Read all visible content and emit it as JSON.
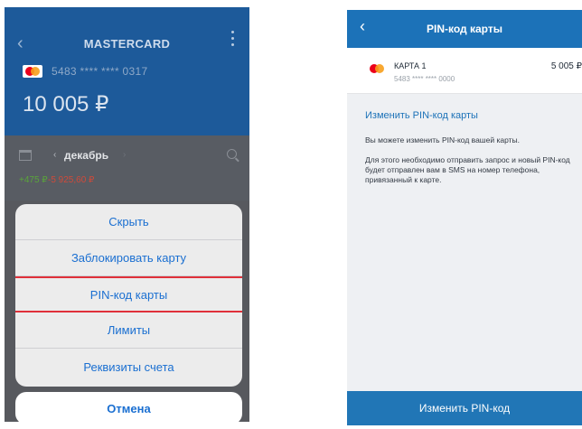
{
  "left_screen": {
    "header": {
      "title": "MASTERCARD",
      "back_icon": "chevron-left-icon",
      "more_icon": "vertical-dots-icon"
    },
    "card": {
      "logo_icon": "mastercard-logo-icon",
      "number": "5483 **** **** 0317",
      "balance": "10 005 ₽"
    },
    "filter": {
      "calendar_icon": "calendar-icon",
      "prev_icon": "‹",
      "month": "декабрь",
      "next_icon": "›",
      "search_icon": "search-icon",
      "income": "+475 ₽",
      "expense": "-5 925,60 ₽"
    },
    "action_sheet": {
      "items": [
        {
          "label": "Скрыть",
          "highlighted": false
        },
        {
          "label": "Заблокировать карту",
          "highlighted": false
        },
        {
          "label": "PIN-код карты",
          "highlighted": true
        },
        {
          "label": "Лимиты",
          "highlighted": false
        },
        {
          "label": "Реквизиты счета",
          "highlighted": false
        }
      ],
      "cancel_label": "Отмена"
    }
  },
  "right_screen": {
    "header": {
      "title": "PIN-код карты",
      "back_icon": "chevron-left-icon"
    },
    "card": {
      "logo_icon": "mastercard-logo-icon",
      "name": "КАРТА 1",
      "number": "5483 **** **** 0000",
      "amount": "5 005 ₽"
    },
    "change_link": "Изменить PIN-код карты",
    "info_text_1": "Вы можете изменить PIN-код вашей карты.",
    "info_text_2": "Для этого необходимо отправить запрос и новый PIN-код будет отправлен вам в SMS на номер телефона, привязанный к карте.",
    "button_label": "Изменить PIN-код"
  },
  "colors": {
    "header_blue": "#1d5a9a",
    "accent_blue": "#1a6fd1",
    "highlight_red": "#e0303a",
    "income_green": "#5aa53a",
    "expense_red": "#d04a3a"
  }
}
